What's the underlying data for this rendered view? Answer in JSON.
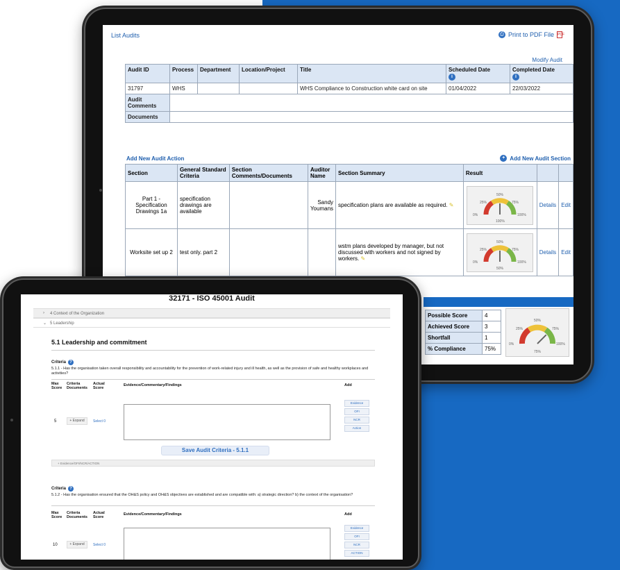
{
  "colors": {
    "brand_blue": "#1769c2",
    "header_cell": "#dbe6f4",
    "link_blue": "#1f5fae"
  },
  "back_tablet": {
    "list_audits": "List Audits",
    "print_pdf": "Print to PDF File",
    "modify_audit": "Modify Audit",
    "audit_headers": [
      "Audit ID",
      "Process",
      "Department",
      "Location/Project",
      "Title",
      "Scheduled Date",
      "Completed Date"
    ],
    "audit_row": {
      "id": "31797",
      "process": "WHS",
      "department": "",
      "location": "",
      "title": "WHS Compliance to Construction white card on site",
      "scheduled": "01/04/2022",
      "completed": "22/03/2022"
    },
    "audit_comments_label": "Audit Comments",
    "documents_label": "Documents",
    "add_action": "Add New Audit Action",
    "add_section": "Add New Audit Section",
    "section_headers": [
      "Section",
      "General Standard Criteria",
      "Section Comments/Documents",
      "Auditor Name",
      "Section Summary",
      "Result"
    ],
    "sections": [
      {
        "section": "Part 1 - Specification Drawings 1a",
        "criteria": "specification drawings are available",
        "comments": "",
        "auditor": "Sandy Youmans",
        "summary": "specification plans are available as required.",
        "details": "Details",
        "edit": "Edit"
      },
      {
        "section": "Worksite set up 2",
        "criteria": "test only. part 2",
        "comments": "",
        "auditor": "",
        "summary": "wstm plans developed by manager, but not discussed with workers and not signed by workers.",
        "details": "Details",
        "edit": "Edit"
      }
    ],
    "gauge_labels": {
      "p0": "0%",
      "p25": "25%",
      "p50": "50%",
      "p75": "75%",
      "p100": "100%"
    },
    "gauge1": {
      "value_pct": 50,
      "readout": "100%"
    },
    "gauge2": {
      "value_pct": 50,
      "readout": "50%"
    },
    "score": {
      "possible_label": "Possible Score",
      "possible": "4",
      "achieved_label": "Achieved Score",
      "achieved": "3",
      "shortfall_label": "Shortfall",
      "shortfall": "1",
      "compliance_label": "% Compliance",
      "compliance": "75%",
      "gauge_value_pct": 75,
      "gauge_readout": "75%"
    }
  },
  "front_tablet": {
    "title": "32171 - ISO 45001 Audit",
    "acc1": "4 Context of the Organization",
    "acc2": "5 Leadership",
    "subsection": "5.1 Leadership and commitment",
    "criteria_label": "Criteria",
    "criteria1": "5.1.1 - Has the organisation taken overall responsibility and accountability for the prevention of work-related injury and ill health, as well as the provision of safe and healthy workplaces and activities?",
    "col_max": "Max Score",
    "col_criteria": "Criteria Documents",
    "col_actual": "Actual Score",
    "col_evidence": "Evidence/Commentary/Findings",
    "col_add": "Add",
    "row1_max": "5",
    "expand": "+ Expand",
    "select1": "Select 0",
    "add_buttons": [
      "Evidence",
      "OFI",
      "NCR",
      "Action"
    ],
    "save": "Save Audit Criteria - 5.1.1",
    "evidence_acc": "+ Evidence/OFI/NCR/ACTION",
    "criteria2": "5.1.2 - Has the organisation ensured that the OH&S policy and OH&S objectives are established and are compatible with: a) strategic direction? b) the context of the organisation?",
    "row2_max": "10",
    "select2": "Select 0",
    "add_buttons2": [
      "Evidence",
      "OFI",
      "NCR",
      "ACTION"
    ]
  }
}
